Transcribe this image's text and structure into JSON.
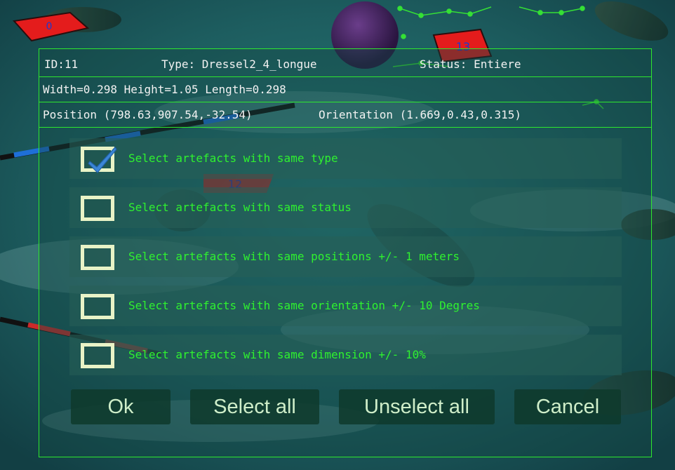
{
  "scene": {
    "markers": [
      "0",
      "13",
      "12"
    ]
  },
  "artefact": {
    "id_text": "ID:11",
    "type_text": "Type: Dressel2_4_longue",
    "status_text": "Status: Entiere",
    "dimensions_text": "Width=0.298 Height=1.05 Length=0.298",
    "position_text": "Position (798.63,907.54,-32.54)",
    "orientation_text": "Orientation (1.669,0.43,0.315)"
  },
  "options": [
    {
      "label": "Select artefacts with same type",
      "checked": true
    },
    {
      "label": "Select artefacts with same status",
      "checked": false
    },
    {
      "label": "Select artefacts with same positions +/- 1 meters",
      "checked": false
    },
    {
      "label": "Select artefacts with same orientation +/- 10 Degres",
      "checked": false
    },
    {
      "label": "Select artefacts with same dimension +/- 10%",
      "checked": false
    }
  ],
  "buttons": {
    "ok": "Ok",
    "select_all": "Select all",
    "unselect_all": "Unselect all",
    "cancel": "Cancel"
  },
  "colors": {
    "accent_green": "#2ee82e",
    "option_text": "#2ff22f",
    "checkmark": "#3b86d6",
    "checkbox_border": "#e9f3c7"
  },
  "icons": {
    "checkmark": "checkmark-icon"
  }
}
